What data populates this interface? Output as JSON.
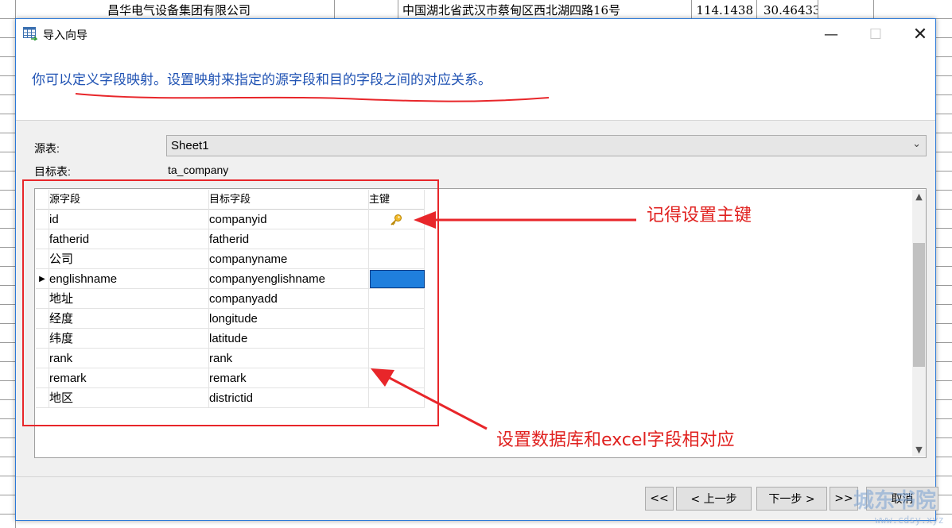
{
  "spreadsheet": {
    "row": {
      "company": "昌华电气设备集团有限公司",
      "address": "中国湖北省武汉市蔡甸区西北湖四路16号",
      "lon": "114.1438",
      "lat": "30.464334"
    }
  },
  "dialog": {
    "title": "导入向导",
    "title_icon": "table-import-icon",
    "window_buttons": {
      "minimize": "—",
      "maximize": "☐",
      "close": "✕"
    },
    "intro": "你可以定义字段映射。设置映射来指定的源字段和目的字段之间的对应关系。",
    "source_label": "源表:",
    "source_value": "Sheet1",
    "target_label": "目标表:",
    "target_value": "ta_company",
    "columns": {
      "source": "源字段",
      "target": "目标字段",
      "primary_key": "主键"
    },
    "rows": [
      {
        "source": "id",
        "target": "companyid",
        "key": true
      },
      {
        "source": "fatherid",
        "target": "fatherid",
        "key": false
      },
      {
        "source": "公司",
        "target": "companyname",
        "key": false
      },
      {
        "source": "englishname",
        "target": "companyenglishname",
        "key": false,
        "current": true
      },
      {
        "source": "地址",
        "target": "companyadd",
        "key": false
      },
      {
        "source": "经度",
        "target": "longitude",
        "key": false
      },
      {
        "source": "纬度",
        "target": "latitude",
        "key": false
      },
      {
        "source": "rank",
        "target": "rank",
        "key": false
      },
      {
        "source": "remark",
        "target": "remark",
        "key": false
      },
      {
        "source": "地区",
        "target": "districtid",
        "key": false
      }
    ],
    "buttons": {
      "first": "<<",
      "prev": "< 上一步",
      "next": "下一步 >",
      "last": ">>",
      "cancel": "取消"
    }
  },
  "annotations": {
    "primary_key_note": "记得设置主键",
    "mapping_note": "设置数据库和excel字段相对应",
    "color": "#e0211f"
  },
  "watermark": {
    "text": "城东书院",
    "sub": "www.cdsy.xyz"
  },
  "colors": {
    "intro_text": "#1f52b3",
    "selected_cell": "#1f7fdd",
    "dialog_border": "#2b79d8"
  }
}
